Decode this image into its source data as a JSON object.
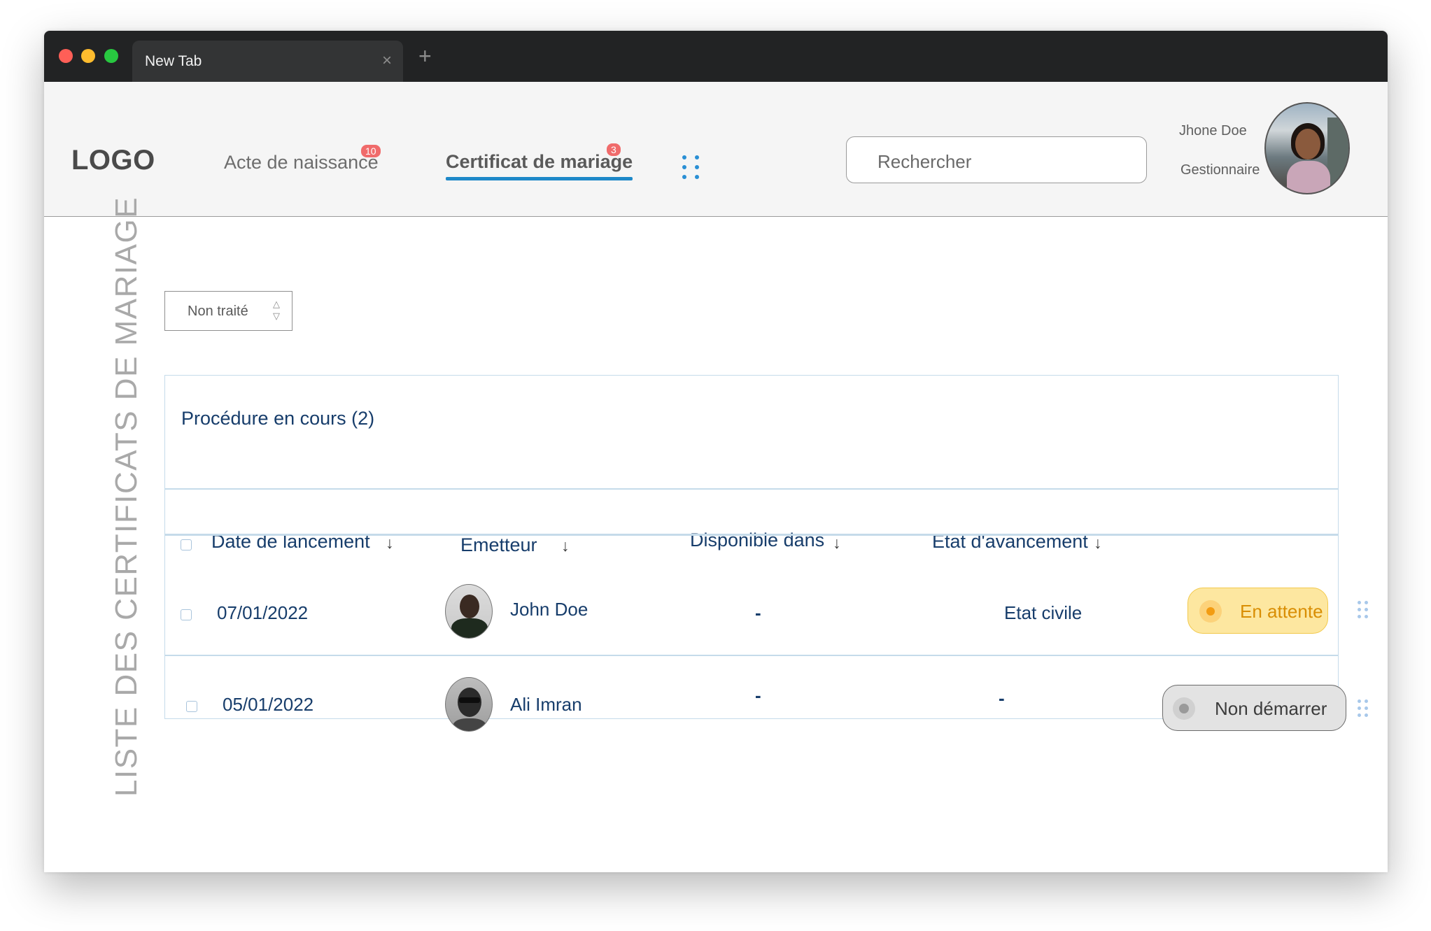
{
  "browser": {
    "tab_title": "New Tab",
    "close_glyph": "×",
    "new_tab_glyph": "+"
  },
  "header": {
    "logo": "LOGO",
    "nav": [
      {
        "label": "Acte de naissance",
        "badge": "10",
        "active": false
      },
      {
        "label": "Certificat de mariage",
        "badge": "3",
        "active": true
      }
    ],
    "grid_icon": "grid-dots-icon",
    "search_placeholder": "Rechercher",
    "user": {
      "name": "Jhone Doe",
      "role": "Gestionnaire"
    }
  },
  "page": {
    "side_title": "LISTE DES CERTIFICATS DE MARIAGE",
    "filter": {
      "value": "Non traité",
      "up_glyph": "△",
      "down_glyph": "▽"
    }
  },
  "table": {
    "title": "Procédure en cours (2)",
    "sort_glyph": "↓",
    "columns": [
      "Date de lancement",
      "Emetteur",
      "Disponible dans",
      "Etat d'avancement"
    ],
    "rows": [
      {
        "date": "07/01/2022",
        "emitter": "John Doe",
        "available_in": "-",
        "progress": "Etat civile",
        "status": "En attente"
      },
      {
        "date": "05/01/2022",
        "emitter": "Ali Imran",
        "available_in": "-",
        "progress": "-",
        "status": "Non démarrer"
      }
    ]
  },
  "colors": {
    "accent": "#1e88c8",
    "primary_text": "#173d6b",
    "badge": "#f06b6b",
    "status_pending": "#fde7a0",
    "status_not_started": "#e3e3e3"
  }
}
